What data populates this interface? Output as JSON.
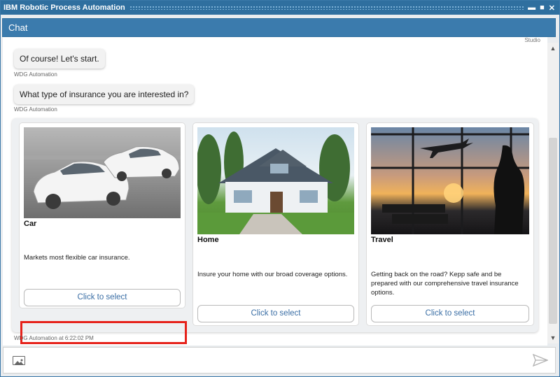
{
  "window": {
    "title": "IBM Robotic Process Automation",
    "controls": [
      "▬",
      "■",
      "✕"
    ]
  },
  "chat_header": {
    "title": "Chat"
  },
  "studio_label": "Studio",
  "messages": [
    {
      "text": "Of course! Let's start.",
      "sender": "WDG Automation"
    },
    {
      "text": "What type of insurance you are interested in?",
      "sender": "WDG Automation"
    }
  ],
  "cards": [
    {
      "title": "Car",
      "description": "Markets most flexible car insurance.",
      "button": "Click to select",
      "icon": "car-image"
    },
    {
      "title": "Home",
      "description": "Insure your home with our broad coverage options.",
      "button": "Click to select",
      "icon": "house-image"
    },
    {
      "title": "Travel",
      "description": "Getting back on the road? Kepp safe and be prepared with our comprehensive travel insurance options.",
      "button": "Click to select",
      "icon": "travel-image"
    }
  ],
  "footer_timestamp": "WDG Automation at 6:22:02 PM",
  "colors": {
    "titlebar": "#2f6f9f",
    "chatbar": "#3b7bad",
    "highlight": "#e6221b",
    "button_text": "#3a6ea5"
  }
}
